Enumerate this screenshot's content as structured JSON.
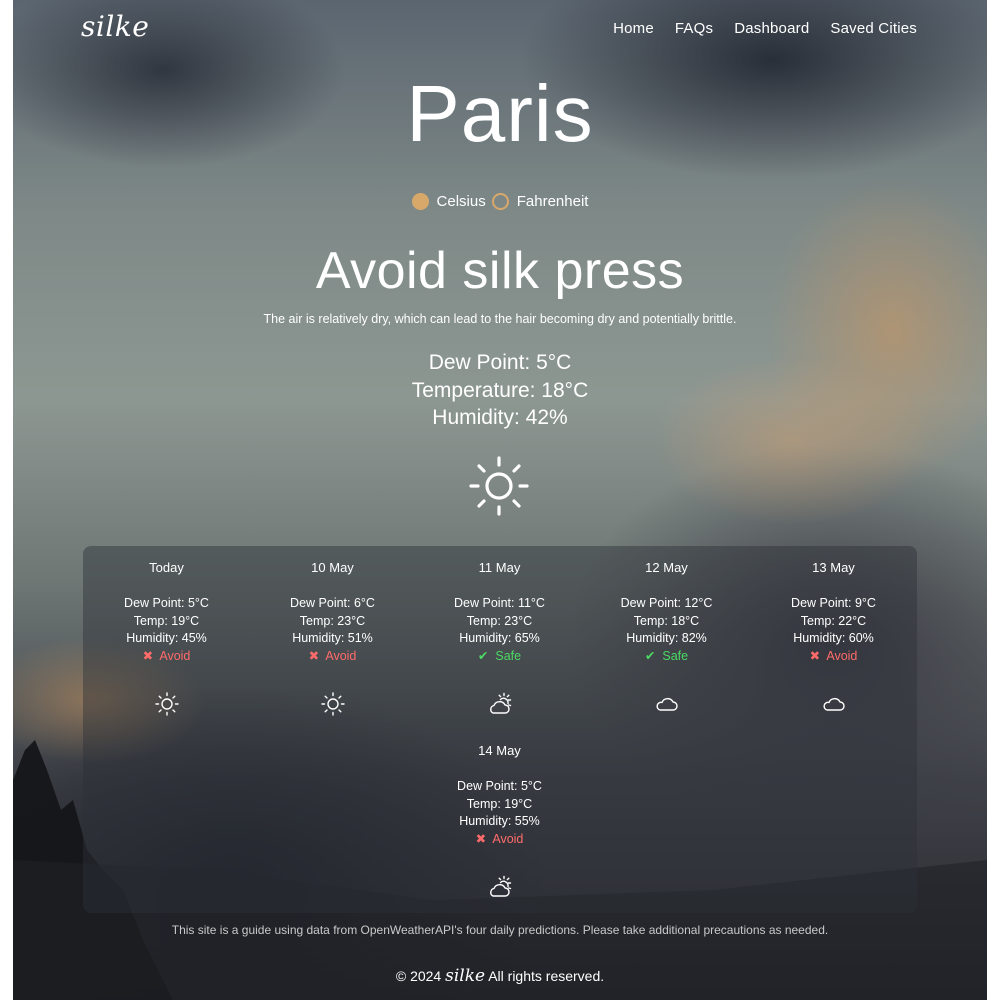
{
  "nav": {
    "logo": "silke",
    "links": [
      "Home",
      "FAQs",
      "Dashboard",
      "Saved Cities"
    ]
  },
  "city": "Paris",
  "units": {
    "celsius": "Celsius",
    "fahrenheit": "Fahrenheit",
    "selected": "Celsius"
  },
  "current": {
    "verdict": "Avoid silk press",
    "description": "The air is relatively dry, which can lead to the hair becoming dry and potentially brittle.",
    "dew_point": "Dew Point: 5°C",
    "temperature": "Temperature: 18°C",
    "humidity": "Humidity: 42%",
    "icon": "sun-icon"
  },
  "forecast": [
    {
      "date": "Today",
      "dew_point": "Dew Point: 5°C",
      "temp": "Temp: 19°C",
      "humidity": "Humidity: 45%",
      "status_mark": "✖",
      "status": "Avoid",
      "icon": "sun-icon"
    },
    {
      "date": "10 May",
      "dew_point": "Dew Point: 6°C",
      "temp": "Temp: 23°C",
      "humidity": "Humidity: 51%",
      "status_mark": "✖",
      "status": "Avoid",
      "icon": "sun-icon"
    },
    {
      "date": "11 May",
      "dew_point": "Dew Point: 11°C",
      "temp": "Temp: 23°C",
      "humidity": "Humidity: 65%",
      "status_mark": "✔",
      "status": "Safe",
      "icon": "partly-cloudy-icon"
    },
    {
      "date": "12 May",
      "dew_point": "Dew Point: 12°C",
      "temp": "Temp: 18°C",
      "humidity": "Humidity: 82%",
      "status_mark": "✔",
      "status": "Safe",
      "icon": "cloud-icon"
    },
    {
      "date": "13 May",
      "dew_point": "Dew Point: 9°C",
      "temp": "Temp: 22°C",
      "humidity": "Humidity: 60%",
      "status_mark": "✖",
      "status": "Avoid",
      "icon": "cloud-icon"
    },
    {
      "date": "14 May",
      "dew_point": "Dew Point: 5°C",
      "temp": "Temp: 19°C",
      "humidity": "Humidity: 55%",
      "status_mark": "✖",
      "status": "Avoid",
      "icon": "partly-cloudy-icon"
    }
  ],
  "disclaimer": "This site is a guide using data from OpenWeatherAPI's four daily predictions. Please take additional precautions as needed.",
  "footer": {
    "prefix": "© 2024",
    "brand": "silke",
    "suffix": "All rights reserved."
  },
  "colors": {
    "radio_accent": "#d8a86a",
    "avoid": "#ff6b6b",
    "safe": "#4cd964"
  }
}
